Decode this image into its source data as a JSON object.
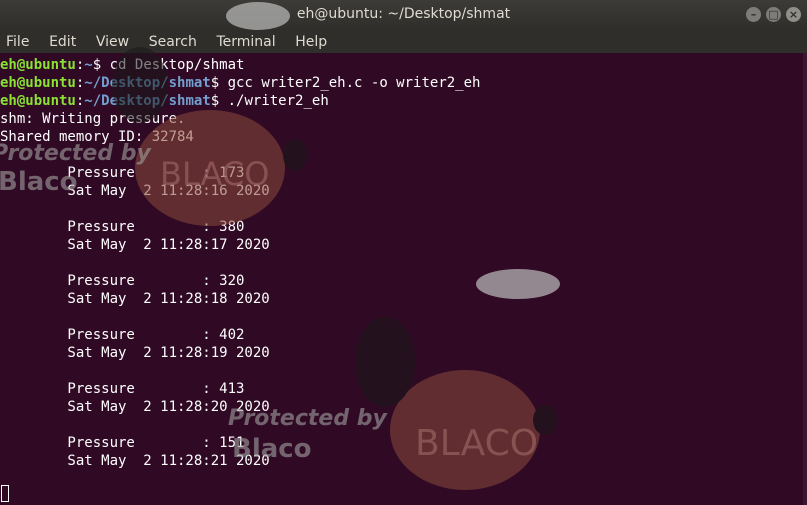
{
  "window": {
    "title": "eh@ubuntu: ~/Desktop/shmat",
    "minimize": "–",
    "maximize": "□",
    "close": "×"
  },
  "menu": [
    "File",
    "Edit",
    "View",
    "Search",
    "Terminal",
    "Help"
  ],
  "terminal": {
    "prompts": [
      {
        "user": "eh@ubuntu",
        "path": "~",
        "cmd": " cd Desktop/shmat"
      },
      {
        "user": "eh@ubuntu",
        "path": "~/Desktop/shmat",
        "cmd": " gcc writer2_eh.c -o writer2_eh"
      },
      {
        "user": "eh@ubuntu",
        "path": "~/Desktop/shmat",
        "cmd": " ./writer2_eh"
      }
    ],
    "output": [
      "shm: Writing pressure.",
      "Shared memory ID: 32784",
      "",
      "        Pressure        : 173",
      "        Sat May  2 11:28:16 2020",
      "",
      "        Pressure        : 380",
      "        Sat May  2 11:28:17 2020",
      "",
      "        Pressure        : 320",
      "        Sat May  2 11:28:18 2020",
      "",
      "        Pressure        : 402",
      "        Sat May  2 11:28:19 2020",
      "",
      "        Pressure        : 413",
      "        Sat May  2 11:28:20 2020",
      "",
      "        Pressure        : 151",
      "        Sat May  2 11:28:21 2020"
    ]
  },
  "watermark": {
    "line1": "Protected by",
    "brand": "Blaco",
    "sheep_text": "BLACO"
  },
  "colors": {
    "bg": "#300a24",
    "user": "#8ae234",
    "path": "#729fcf"
  }
}
